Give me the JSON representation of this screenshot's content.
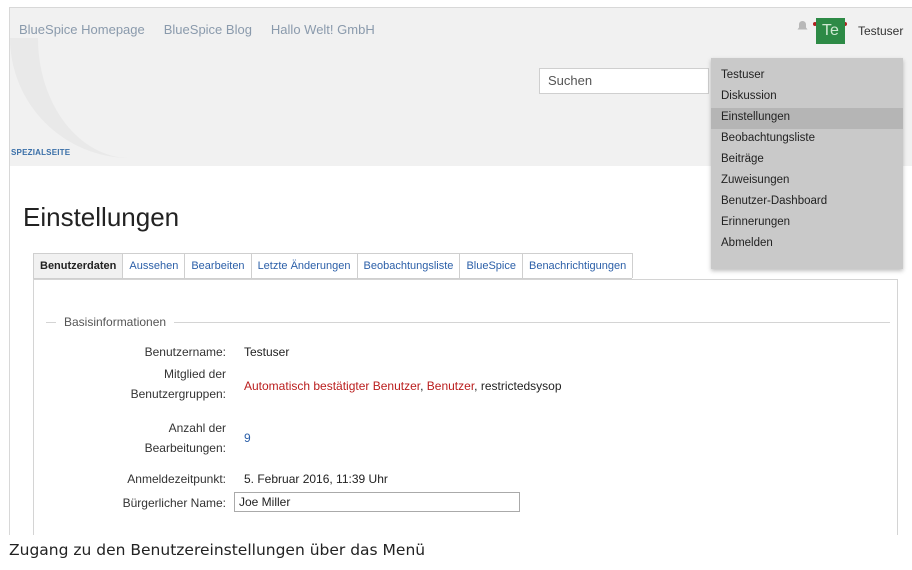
{
  "top_nav": {
    "links": [
      "BlueSpice Homepage",
      "BlueSpice Blog",
      "Hallo Welt! GmbH"
    ],
    "user_initials": "Te",
    "username": "Testuser"
  },
  "search": {
    "placeholder": "Suchen"
  },
  "namespace_label": "SPEZIALSEITE",
  "page_title": "Einstellungen",
  "tabs": [
    {
      "label": "Benutzerdaten",
      "active": true
    },
    {
      "label": "Aussehen",
      "active": false
    },
    {
      "label": "Bearbeiten",
      "active": false
    },
    {
      "label": "Letzte Änderungen",
      "active": false
    },
    {
      "label": "Beobachtungsliste",
      "active": false
    },
    {
      "label": "BlueSpice",
      "active": false
    },
    {
      "label": "Benachrichtigungen",
      "active": false
    }
  ],
  "basic_info": {
    "legend": "Basisinformationen",
    "username_label": "Benutzername:",
    "username_value": "Testuser",
    "groups_label": "Mitglied der Benutzergruppen:",
    "groups": [
      "Automatisch bestätigter Benutzer",
      "Benutzer",
      "restrictedsysop"
    ],
    "edits_label": "Anzahl der Bearbeitungen:",
    "edits_value": "9",
    "login_label": "Anmeldezeitpunkt:",
    "login_value": "5. Februar 2016, 11:39 Uhr",
    "realname_label": "Bürgerlicher Name:",
    "realname_value": "Joe Miller"
  },
  "user_menu": {
    "items": [
      "Testuser",
      "Diskussion",
      "Einstellungen",
      "Beobachtungsliste",
      "Beiträge",
      "Zuweisungen",
      "Benutzer-Dashboard",
      "Erinnerungen",
      "Abmelden"
    ],
    "highlighted": "Einstellungen"
  },
  "caption": "Zugang zu den Benutzereinstellungen über das Menü",
  "colors": {
    "avatar_bg": "#2d8a46",
    "link": "#2b5fa8",
    "group_link": "#ba1d1d",
    "menu_bg": "#c9c9c9"
  }
}
